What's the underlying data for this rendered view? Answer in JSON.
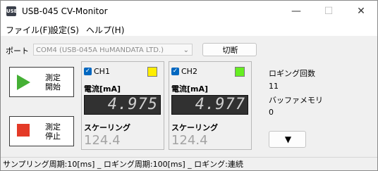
{
  "window": {
    "title": "USB-045 CV-Monitor",
    "icon_text": "USB",
    "minimize": "—",
    "maximize": "☐",
    "close": "✕"
  },
  "menu": [
    "ファイル(F)",
    "設定(S)",
    "ヘルプ(H)"
  ],
  "port": {
    "label": "ポート",
    "value": "COM4 (USB-045A HuMANDATA LTD.)",
    "disconnect_label": "切断"
  },
  "controls": {
    "start_label_1": "測定",
    "start_label_2": "開始",
    "stop_label_1": "測定",
    "stop_label_2": "停止"
  },
  "channels": [
    {
      "name": "CH1",
      "checked": true,
      "color": "#ffee00",
      "current_label": "電流[mA]",
      "current": "4.975",
      "scaling_label": "スケーリング",
      "scaling": "124.4"
    },
    {
      "name": "CH2",
      "checked": true,
      "color": "#66ee22",
      "current_label": "電流[mA]",
      "current": "4.977",
      "scaling_label": "スケーリング",
      "scaling": "124.4"
    }
  ],
  "logging": {
    "count_label": "ロギング回数",
    "count": "11",
    "buffer_label": "バッファメモリ",
    "buffer": "0",
    "expand_button": "▼"
  },
  "status": "サンプリング周期:10[ms] _ ロギング周期:100[ms] _ ロギング:連続"
}
